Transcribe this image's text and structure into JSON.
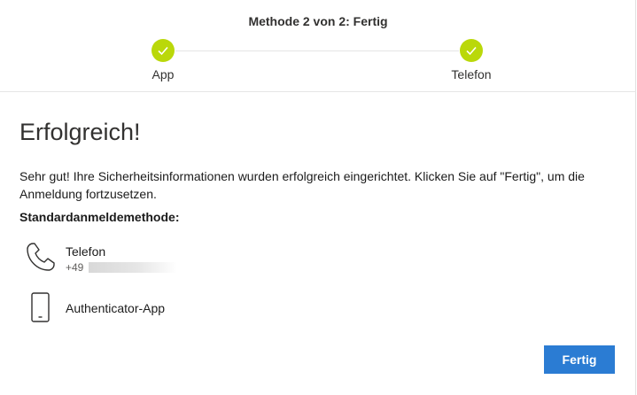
{
  "stepper": {
    "title": "Methode 2 von 2: Fertig",
    "steps": [
      {
        "label": "App",
        "status": "complete"
      },
      {
        "label": "Telefon",
        "status": "complete"
      }
    ],
    "complete_color": "#bad80a"
  },
  "content": {
    "heading": "Erfolgreich!",
    "message": "Sehr gut! Ihre Sicherheitsinformationen wurden erfolgreich eingerichtet. Klicken Sie auf \"Fertig\", um die Anmeldung fortzusetzen.",
    "default_method_label": "Standardanmeldemethode:",
    "methods": [
      {
        "icon": "phone-icon",
        "name": "Telefon",
        "detail": "+49"
      },
      {
        "icon": "mobile-device-icon",
        "name": "Authenticator-App"
      }
    ]
  },
  "actions": {
    "done_label": "Fertig",
    "button_color": "#2b7cd3"
  }
}
